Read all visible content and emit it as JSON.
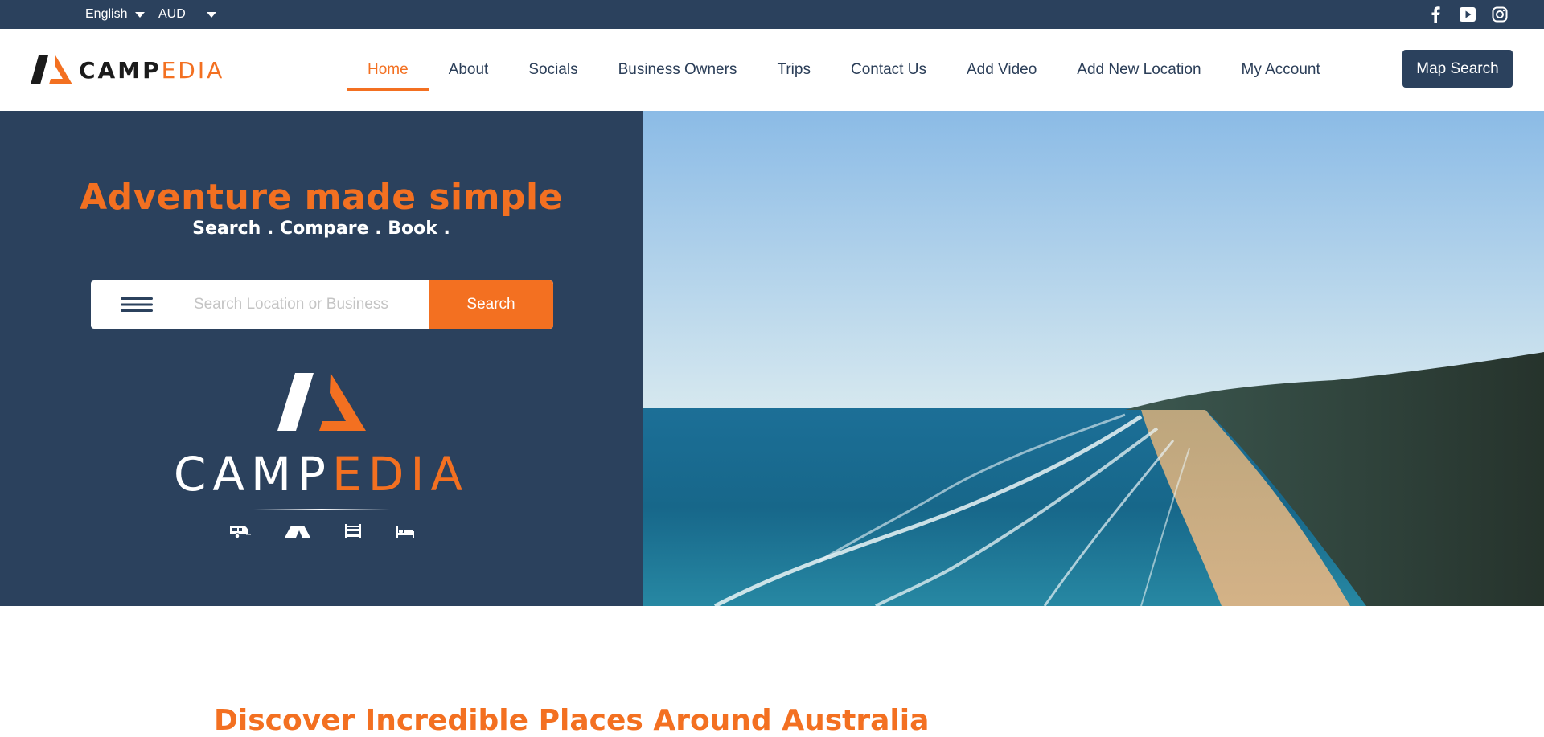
{
  "topbar": {
    "language": "English",
    "currency": "AUD",
    "socials": [
      "facebook-icon",
      "youtube-icon",
      "instagram-icon"
    ]
  },
  "header": {
    "logo_part1": "CAMP",
    "logo_part2": "EDIA",
    "nav": [
      {
        "label": "Home",
        "active": true
      },
      {
        "label": "About"
      },
      {
        "label": "Socials"
      },
      {
        "label": "Business Owners"
      },
      {
        "label": "Trips"
      },
      {
        "label": "Contact Us"
      },
      {
        "label": "Add Video"
      },
      {
        "label": "Add New Location"
      },
      {
        "label": "My Account"
      }
    ],
    "map_search": "Map Search"
  },
  "hero": {
    "headline": "Adventure made simple",
    "subline": "Search . Compare . Book .",
    "search_placeholder": "Search Location or Business",
    "search_button": "Search",
    "logo_part1": "CAMP",
    "logo_part2": "EDIA",
    "amenity_icons": [
      "caravan-icon",
      "tent-icon",
      "bunk-bed-icon",
      "bed-icon"
    ]
  },
  "section": {
    "heading": "Discover Incredible Places Around Australia"
  },
  "colors": {
    "navy": "#2b415d",
    "orange": "#f37021"
  }
}
